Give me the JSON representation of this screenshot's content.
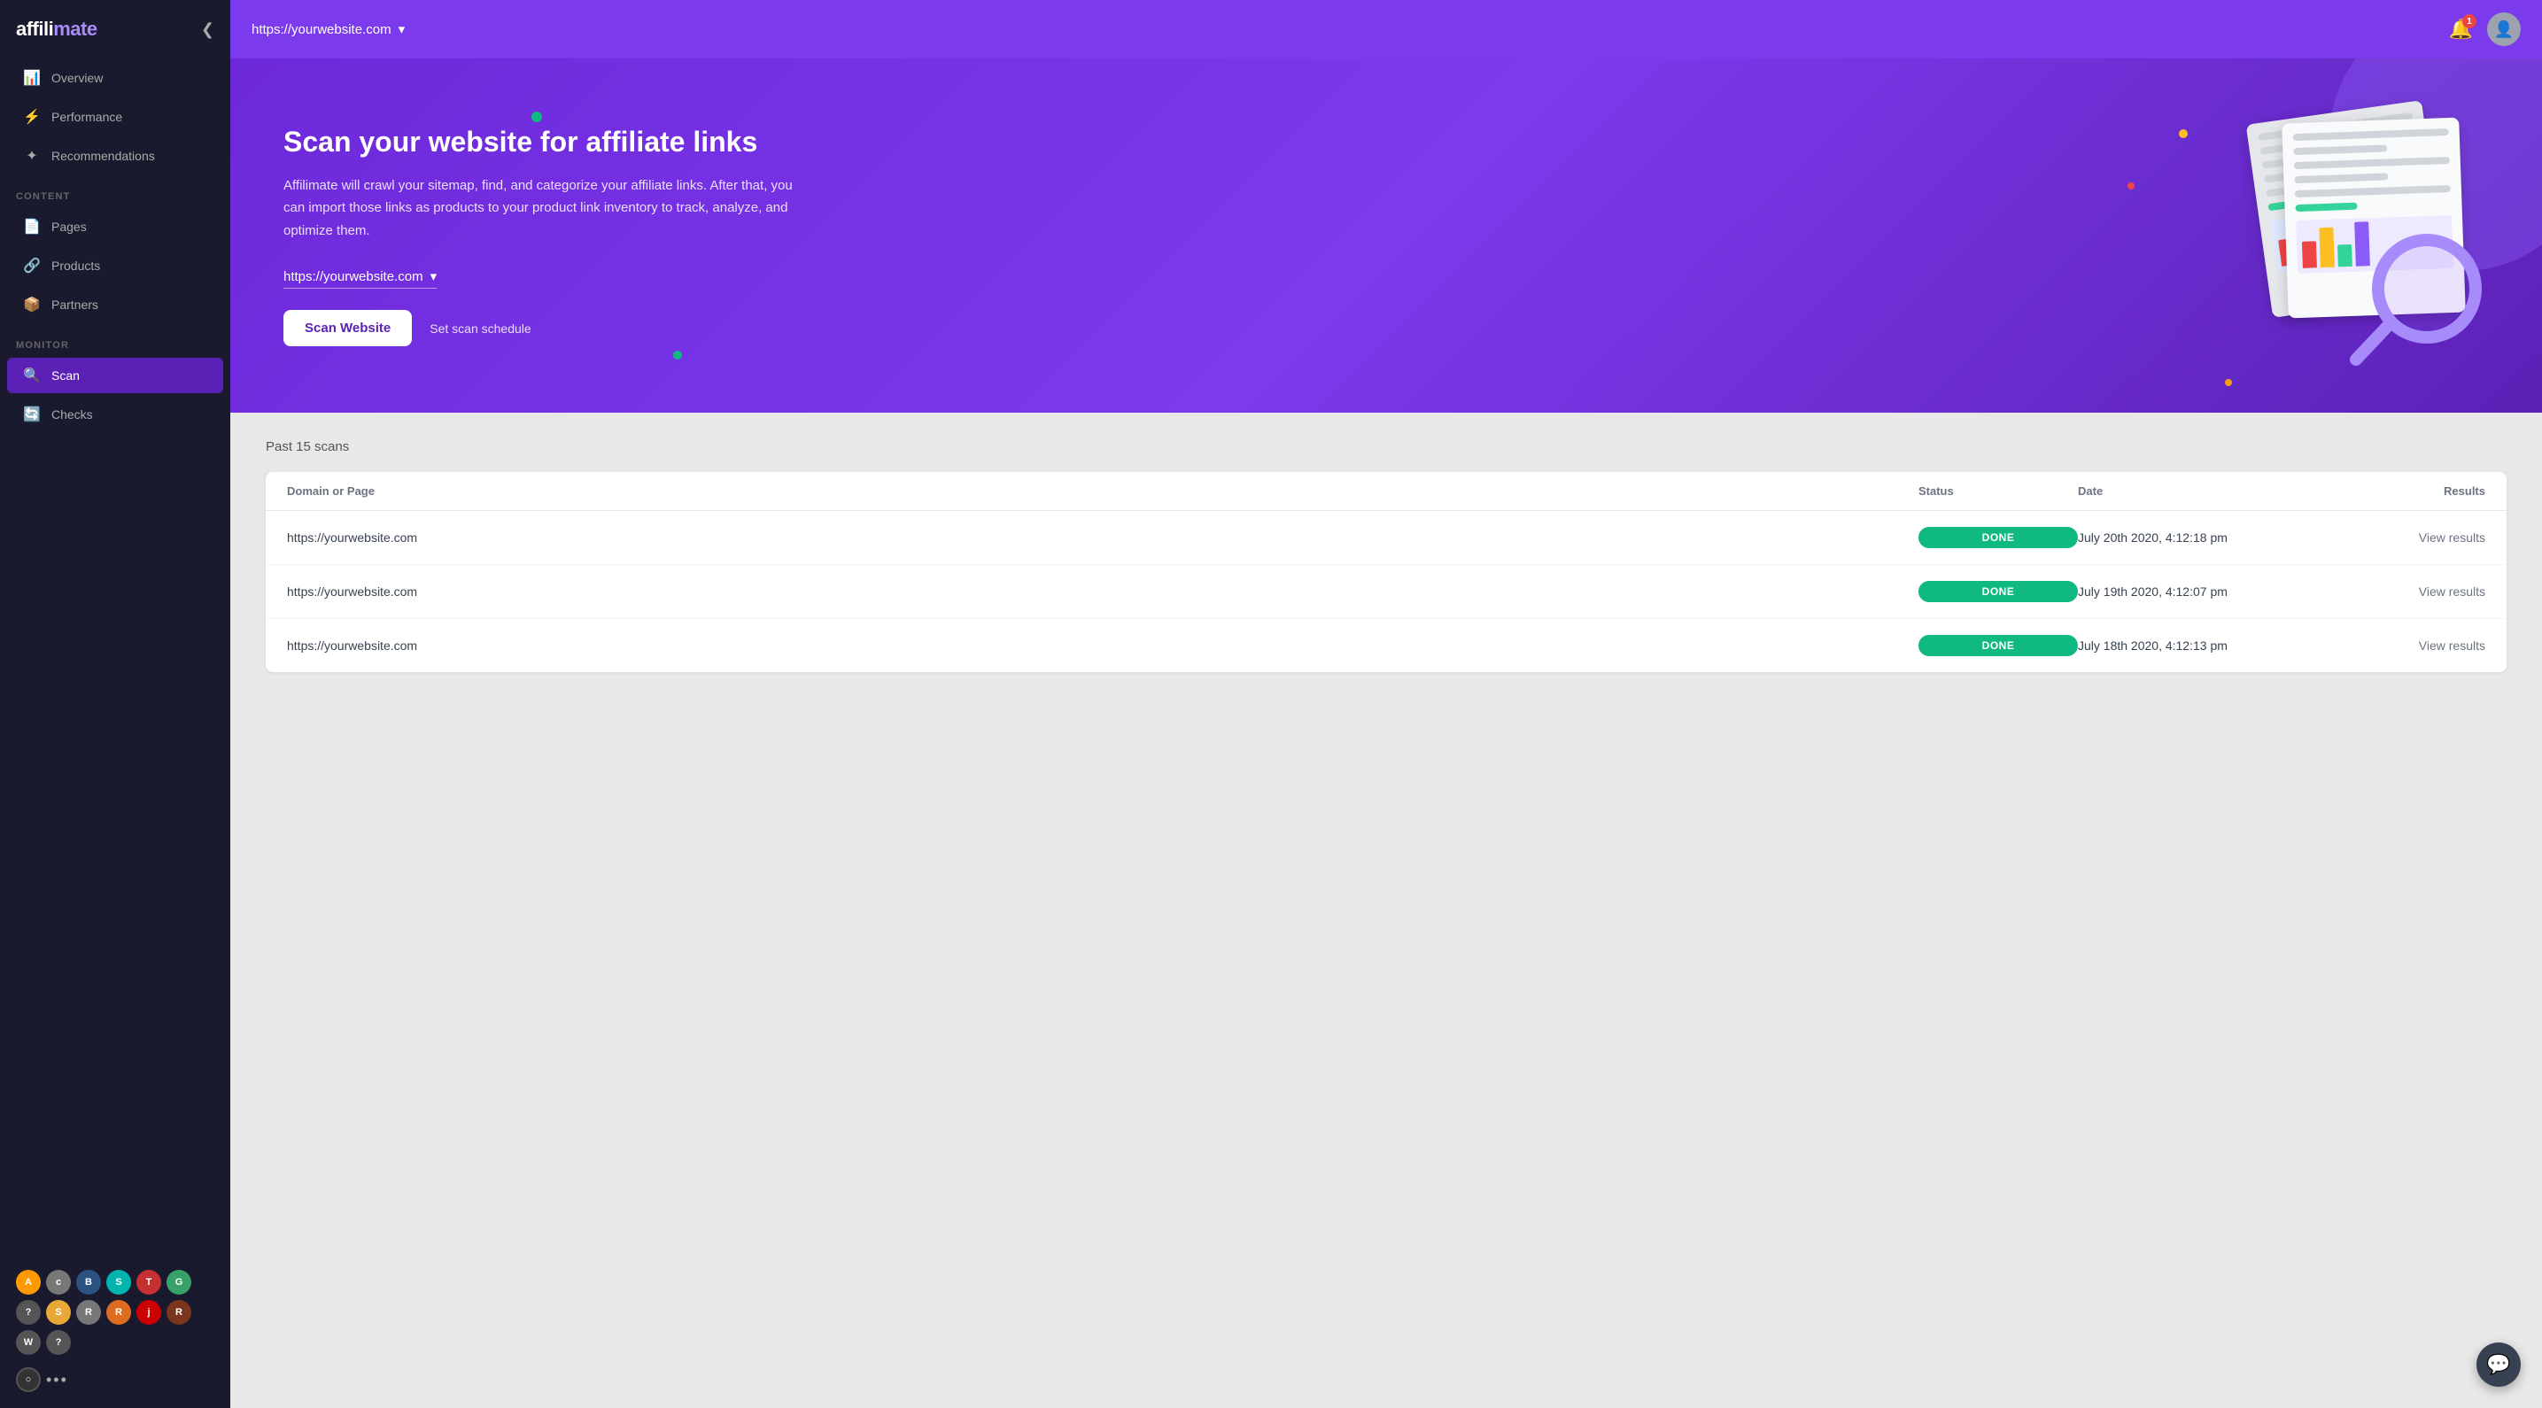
{
  "app": {
    "name": "affilimate",
    "logo_accent": "mate"
  },
  "topbar": {
    "domain": "https://yourwebsite.com",
    "domain_dropdown": "▾",
    "notification_count": "1"
  },
  "sidebar": {
    "collapse_icon": "❮",
    "nav_items": [
      {
        "id": "overview",
        "label": "Overview",
        "icon": "📊",
        "active": false
      },
      {
        "id": "performance",
        "label": "Performance",
        "icon": "⚡",
        "active": false
      },
      {
        "id": "recommendations",
        "label": "Recommendations",
        "icon": "✦",
        "active": false
      }
    ],
    "content_label": "CONTENT",
    "content_items": [
      {
        "id": "pages",
        "label": "Pages",
        "icon": "📄",
        "active": false
      },
      {
        "id": "products",
        "label": "Products",
        "icon": "🔗",
        "active": false
      },
      {
        "id": "partners",
        "label": "Partners",
        "icon": "📦",
        "active": false
      }
    ],
    "monitor_label": "MONITOR",
    "monitor_items": [
      {
        "id": "scan",
        "label": "Scan",
        "icon": "🔍",
        "active": true
      },
      {
        "id": "checks",
        "label": "Checks",
        "icon": "🔄",
        "active": false
      }
    ],
    "partner_icons": [
      {
        "label": "A",
        "color": "#ff9900"
      },
      {
        "label": "c",
        "color": "#888"
      },
      {
        "label": "B",
        "color": "#2c5282"
      },
      {
        "label": "S",
        "color": "#00b5ad"
      },
      {
        "label": "T",
        "color": "#c53030"
      },
      {
        "label": "G",
        "color": "#38a169"
      },
      {
        "label": "?",
        "color": "#555"
      },
      {
        "label": "S",
        "color": "#e8a838"
      },
      {
        "label": "R",
        "color": "#888"
      },
      {
        "label": "R",
        "color": "#dd6b20"
      },
      {
        "label": "j",
        "color": "#cc0000"
      },
      {
        "label": "R",
        "color": "#7b341e"
      },
      {
        "label": "W",
        "color": "#555"
      },
      {
        "label": "?",
        "color": "#555"
      }
    ]
  },
  "hero": {
    "title": "Scan your website for affiliate links",
    "description": "Affilimate will crawl your sitemap, find, and categorize your affiliate links. After that, you can import those links as products to your product link inventory to track, analyze, and optimize them.",
    "url_selector": "https://yourwebsite.com",
    "scan_button": "Scan Website",
    "schedule_link": "Set scan schedule"
  },
  "scans": {
    "title": "Past 15 scans",
    "columns": [
      "Domain or Page",
      "Status",
      "Date",
      "Results"
    ],
    "rows": [
      {
        "domain": "https://yourwebsite.com",
        "status": "DONE",
        "date": "July 20th 2020, 4:12:18 pm",
        "results": "View results"
      },
      {
        "domain": "https://yourwebsite.com",
        "status": "DONE",
        "date": "July 19th 2020, 4:12:07 pm",
        "results": "View results"
      },
      {
        "domain": "https://yourwebsite.com",
        "status": "DONE",
        "date": "July 18th 2020, 4:12:13 pm",
        "results": "View results"
      }
    ]
  },
  "chat": {
    "icon": "💬"
  }
}
